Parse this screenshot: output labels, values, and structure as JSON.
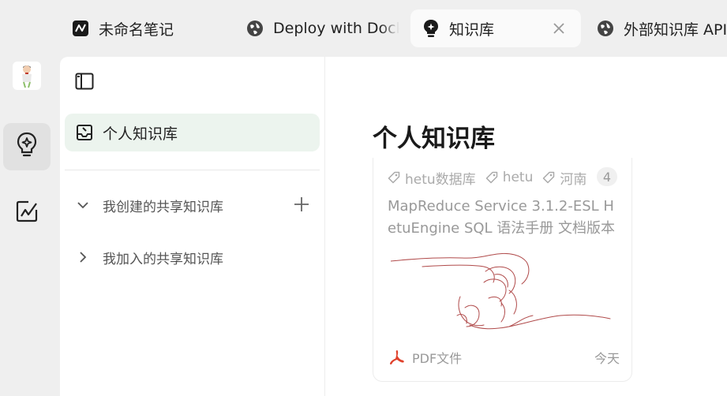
{
  "tabs": [
    {
      "label": "未命名笔记",
      "icon": "note-icon"
    },
    {
      "label": "Deploy with Docker",
      "icon": "globe-icon"
    },
    {
      "label": "知识库",
      "icon": "bulb-icon",
      "active": true
    },
    {
      "label": "外部知识库 API",
      "icon": "globe-icon"
    }
  ],
  "sidebar": {
    "personal_label": "个人知识库",
    "groups": [
      {
        "label": "我创建的共享知识库",
        "expanded": true
      },
      {
        "label": "我加入的共享知识库",
        "expanded": false
      }
    ]
  },
  "main": {
    "title": "个人知识库",
    "card": {
      "tags": [
        "hetu数据库",
        "hetu",
        "河南"
      ],
      "tag_count": "4",
      "description": "MapReduce Service 3.1.2-ESL HetuEngine SQL 语法手册 文档版本 ...",
      "file_type": "PDF文件",
      "date": "今天"
    }
  },
  "colors": {
    "accent_bg": "#ecf4ee",
    "pdf_red": "#e0412c"
  }
}
